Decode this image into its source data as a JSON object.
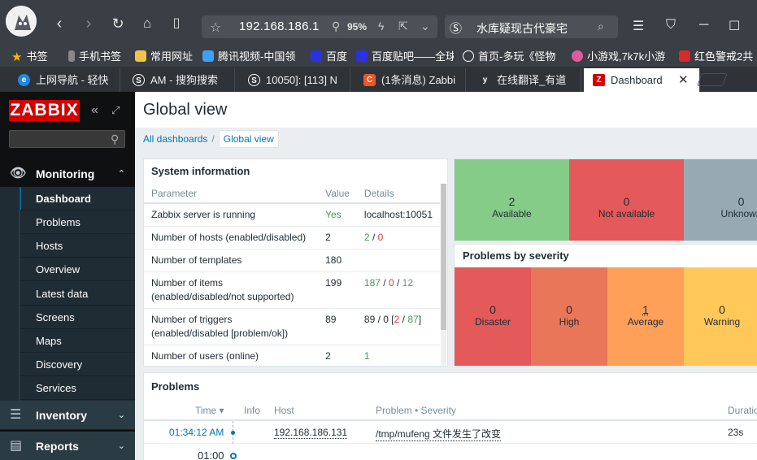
{
  "browser": {
    "url": "192.168.186.1",
    "zoom": "95%",
    "search": "水库疑现古代豪宅",
    "bookmarks": [
      "书签",
      "手机书签",
      "常用网址",
      "腾讯视频-中国领",
      "百度",
      "百度贴吧——全球",
      "首页-多玩《怪物",
      "小游戏,7k7k小游",
      "红色警戒2共"
    ],
    "tabs": [
      "上网导航 - 轻快",
      "AM - 搜狗搜索",
      "10050]: [113] N",
      "(1条消息) Zabbi",
      "在线翻译_有道",
      "Dashboard"
    ]
  },
  "sidebar": {
    "logo": "ZABBIX",
    "monitoring": "Monitoring",
    "items": [
      "Dashboard",
      "Problems",
      "Hosts",
      "Overview",
      "Latest data",
      "Screens",
      "Maps",
      "Discovery",
      "Services"
    ],
    "inventory": "Inventory",
    "reports": "Reports"
  },
  "header": {
    "title": "Global view",
    "crumb_all": "All dashboards",
    "crumb_current": "Global view"
  },
  "sysinfo": {
    "title": "System information",
    "col_param": "Parameter",
    "col_value": "Value",
    "col_details": "Details",
    "rows": [
      {
        "param": "Zabbix server is running",
        "value": "Yes",
        "details": "localhost:10051"
      },
      {
        "param": "Number of hosts (enabled/disabled)",
        "value": "2",
        "d1": "2",
        "d2": "0"
      },
      {
        "param": "Number of templates",
        "value": "180"
      },
      {
        "param": "Number of items (enabled/disabled/not supported)",
        "value": "199",
        "d1": "187",
        "d2": "0",
        "d3": "12"
      },
      {
        "param": "Number of triggers (enabled/disabled [problem/ok])",
        "value": "89",
        "d1": "89 / 0 [",
        "d2": "2",
        "d3": "87",
        "d4": "]"
      },
      {
        "param": "Number of users (online)",
        "value": "2",
        "d1": "1"
      }
    ]
  },
  "host_availability": [
    {
      "count": "2",
      "label": "Available",
      "color": "#86cc89"
    },
    {
      "count": "0",
      "label": "Not available",
      "color": "#e45959"
    },
    {
      "count": "0",
      "label": "Unknown",
      "color": "#97aab3"
    }
  ],
  "severity": {
    "title": "Problems by severity",
    "cells": [
      {
        "count": "0",
        "label": "Disaster",
        "color": "#e45959"
      },
      {
        "count": "0",
        "label": "High",
        "color": "#e97659"
      },
      {
        "count": "1",
        "label": "Average",
        "color": "#ffa059"
      },
      {
        "count": "0",
        "label": "Warning",
        "color": "#ffc859"
      }
    ]
  },
  "problems": {
    "title": "Problems",
    "col_time": "Time ▾",
    "col_info": "Info",
    "col_host": "Host",
    "col_problem": "Problem • Severity",
    "col_duration": "Duratio",
    "rows": [
      {
        "time": "01:34:12 AM",
        "host": "192.168.186.131",
        "problem": "/tmp/mufeng 文件发生了改变",
        "duration": "23s"
      }
    ],
    "next_time": "01:00"
  }
}
